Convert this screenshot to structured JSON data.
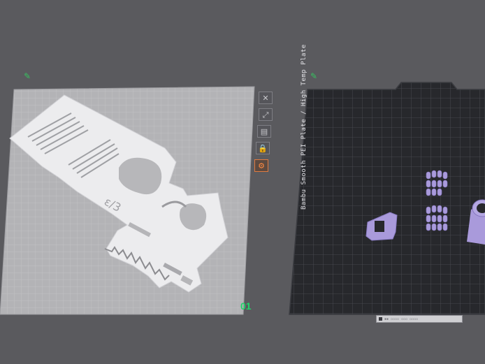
{
  "colors": {
    "background": "#5a5a5e",
    "plate_left": "#b3b3b6",
    "plate_right": "#27282c",
    "model_white": "#ececee",
    "model_purple": "#a99adb",
    "plate_index": "#1fd56a"
  },
  "plate_left": {
    "index_label": "01",
    "edit_icon": "pencil-icon",
    "model_text": "ε/3"
  },
  "plate_right": {
    "edit_icon": "pencil-icon",
    "plate_label": "Bambu Smooth PEI Plate / High Temp Plate",
    "status_text": "▪▪ ▫▫▫▫ ▫▫▫ ▫▫▫▫"
  },
  "plate_toolbar": [
    {
      "icon": "close-icon",
      "glyph": "✕"
    },
    {
      "icon": "orient-icon",
      "glyph": "⤢"
    },
    {
      "icon": "arrange-icon",
      "glyph": "▤"
    },
    {
      "icon": "lock-icon",
      "glyph": "🔒"
    },
    {
      "icon": "settings-icon",
      "glyph": "⚙"
    }
  ]
}
